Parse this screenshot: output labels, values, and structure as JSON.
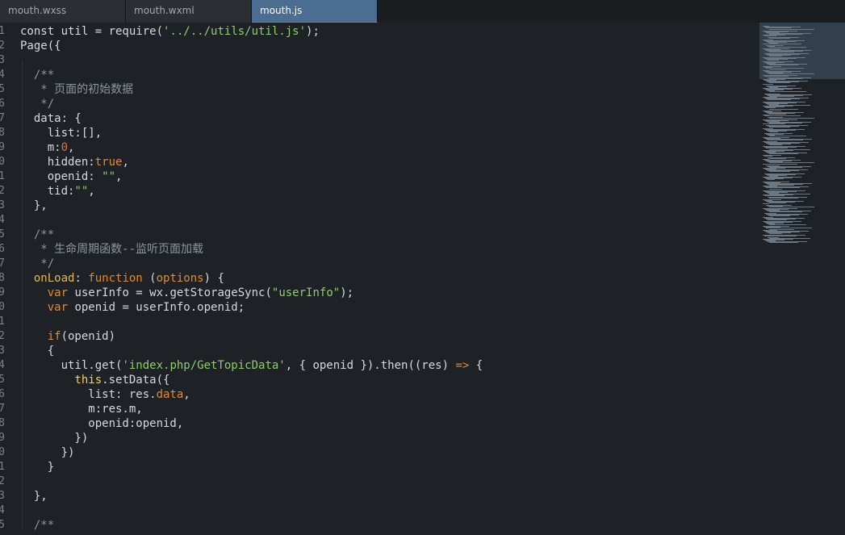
{
  "tabs": [
    {
      "label": "mouth.wxss",
      "active": false
    },
    {
      "label": "mouth.wxml",
      "active": false
    },
    {
      "label": "mouth.js",
      "active": true
    }
  ],
  "line_numbers": [
    "1",
    "2",
    "3",
    "4",
    "5",
    "6",
    "7",
    "8",
    "9",
    "0",
    "1",
    "2",
    "3",
    "4",
    "5",
    "6",
    "7",
    "8",
    "9",
    "0",
    "1",
    "2",
    "3",
    "4",
    "5",
    "6",
    "7",
    "8",
    "9",
    "0",
    "1",
    "2",
    "3",
    "4",
    "5"
  ],
  "code_lines": [
    [
      {
        "t": "const util = require(",
        "c": "plain"
      },
      {
        "t": "'../../utils/util.js'",
        "c": "str"
      },
      {
        "t": ");",
        "c": "plain"
      }
    ],
    [
      {
        "t": "Page({",
        "c": "plain"
      }
    ],
    [
      {
        "t": "",
        "c": "plain"
      }
    ],
    [
      {
        "t": "  /**",
        "c": "com"
      }
    ],
    [
      {
        "t": "   * 页面的初始数据",
        "c": "com"
      }
    ],
    [
      {
        "t": "   */",
        "c": "com"
      }
    ],
    [
      {
        "t": "  data: {",
        "c": "plain"
      }
    ],
    [
      {
        "t": "    list:[],",
        "c": "plain"
      }
    ],
    [
      {
        "t": "    m:",
        "c": "plain"
      },
      {
        "t": "0",
        "c": "num"
      },
      {
        "t": ",",
        "c": "plain"
      }
    ],
    [
      {
        "t": "    hidden:",
        "c": "plain"
      },
      {
        "t": "true",
        "c": "bool"
      },
      {
        "t": ",",
        "c": "plain"
      }
    ],
    [
      {
        "t": "    openid: ",
        "c": "plain"
      },
      {
        "t": "\"\"",
        "c": "str"
      },
      {
        "t": ",",
        "c": "plain"
      }
    ],
    [
      {
        "t": "    tid:",
        "c": "plain"
      },
      {
        "t": "\"\"",
        "c": "str"
      },
      {
        "t": ",",
        "c": "plain"
      }
    ],
    [
      {
        "t": "  },",
        "c": "plain"
      }
    ],
    [
      {
        "t": "",
        "c": "plain"
      }
    ],
    [
      {
        "t": "  /**",
        "c": "com"
      }
    ],
    [
      {
        "t": "   * 生命周期函数--监听页面加载",
        "c": "com"
      }
    ],
    [
      {
        "t": "   */",
        "c": "com"
      }
    ],
    [
      {
        "t": "  onLoad",
        "c": "fn"
      },
      {
        "t": ": ",
        "c": "plain"
      },
      {
        "t": "function",
        "c": "kw"
      },
      {
        "t": " (",
        "c": "plain"
      },
      {
        "t": "options",
        "c": "kw"
      },
      {
        "t": ") {",
        "c": "plain"
      }
    ],
    [
      {
        "t": "    ",
        "c": "plain"
      },
      {
        "t": "var",
        "c": "kw"
      },
      {
        "t": " userInfo = wx.getStorageSync(",
        "c": "plain"
      },
      {
        "t": "\"userInfo\"",
        "c": "str"
      },
      {
        "t": ");",
        "c": "plain"
      }
    ],
    [
      {
        "t": "    ",
        "c": "plain"
      },
      {
        "t": "var",
        "c": "kw"
      },
      {
        "t": " openid = userInfo.openid;",
        "c": "plain"
      }
    ],
    [
      {
        "t": "",
        "c": "plain"
      }
    ],
    [
      {
        "t": "    ",
        "c": "plain"
      },
      {
        "t": "if",
        "c": "kw"
      },
      {
        "t": "(openid)",
        "c": "plain"
      }
    ],
    [
      {
        "t": "    {",
        "c": "plain"
      }
    ],
    [
      {
        "t": "      util.get(",
        "c": "plain"
      },
      {
        "t": "'index.php/GetTopicData'",
        "c": "str"
      },
      {
        "t": ", { openid }).then((res) ",
        "c": "plain"
      },
      {
        "t": "=>",
        "c": "kw"
      },
      {
        "t": " {",
        "c": "plain"
      }
    ],
    [
      {
        "t": "        ",
        "c": "plain"
      },
      {
        "t": "this",
        "c": "this"
      },
      {
        "t": ".setData({",
        "c": "plain"
      }
    ],
    [
      {
        "t": "          list: res.",
        "c": "plain"
      },
      {
        "t": "data",
        "c": "kw"
      },
      {
        "t": ",",
        "c": "plain"
      }
    ],
    [
      {
        "t": "          m:res.m,",
        "c": "plain"
      }
    ],
    [
      {
        "t": "          openid:openid,",
        "c": "plain"
      }
    ],
    [
      {
        "t": "        })",
        "c": "plain"
      }
    ],
    [
      {
        "t": "      })",
        "c": "plain"
      }
    ],
    [
      {
        "t": "    }",
        "c": "plain"
      }
    ],
    [
      {
        "t": "",
        "c": "plain"
      }
    ],
    [
      {
        "t": "  },",
        "c": "plain"
      }
    ],
    [
      {
        "t": "",
        "c": "plain"
      }
    ],
    [
      {
        "t": "  /**",
        "c": "com"
      }
    ]
  ]
}
